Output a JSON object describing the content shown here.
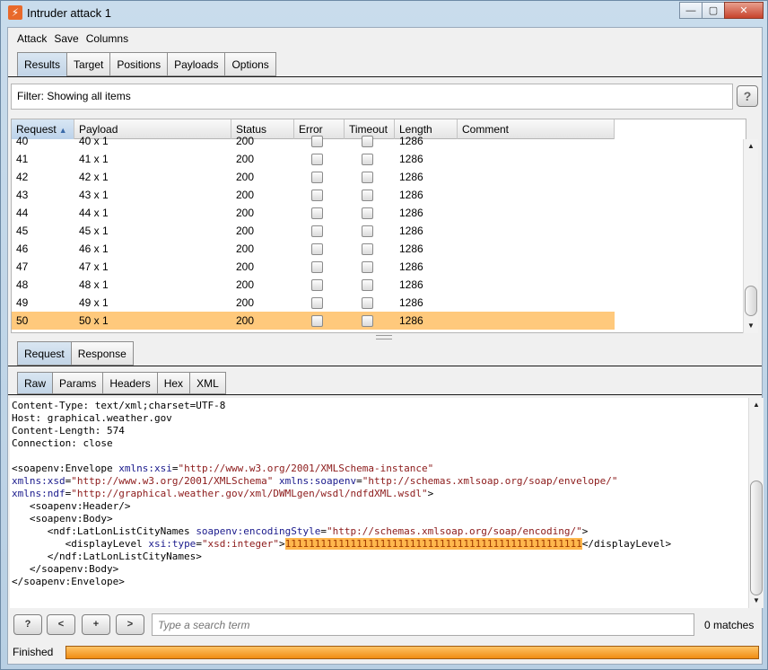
{
  "window": {
    "title": "Intruder attack 1"
  },
  "menu": [
    "Attack",
    "Save",
    "Columns"
  ],
  "top_tabs": [
    "Results",
    "Target",
    "Positions",
    "Payloads",
    "Options"
  ],
  "filter": {
    "text": "Filter: Showing all items",
    "help": "?"
  },
  "table": {
    "columns": [
      "Request",
      "Payload",
      "Status",
      "Error",
      "Timeout",
      "Length",
      "Comment"
    ],
    "sort_indicator": "▲",
    "rows": [
      {
        "request": "40",
        "payload": "40 x 1",
        "status": "200",
        "error": false,
        "timeout": false,
        "length": "1286",
        "comment": ""
      },
      {
        "request": "41",
        "payload": "41 x 1",
        "status": "200",
        "error": false,
        "timeout": false,
        "length": "1286",
        "comment": ""
      },
      {
        "request": "42",
        "payload": "42 x 1",
        "status": "200",
        "error": false,
        "timeout": false,
        "length": "1286",
        "comment": ""
      },
      {
        "request": "43",
        "payload": "43 x 1",
        "status": "200",
        "error": false,
        "timeout": false,
        "length": "1286",
        "comment": ""
      },
      {
        "request": "44",
        "payload": "44 x 1",
        "status": "200",
        "error": false,
        "timeout": false,
        "length": "1286",
        "comment": ""
      },
      {
        "request": "45",
        "payload": "45 x 1",
        "status": "200",
        "error": false,
        "timeout": false,
        "length": "1286",
        "comment": ""
      },
      {
        "request": "46",
        "payload": "46 x 1",
        "status": "200",
        "error": false,
        "timeout": false,
        "length": "1286",
        "comment": ""
      },
      {
        "request": "47",
        "payload": "47 x 1",
        "status": "200",
        "error": false,
        "timeout": false,
        "length": "1286",
        "comment": ""
      },
      {
        "request": "48",
        "payload": "48 x 1",
        "status": "200",
        "error": false,
        "timeout": false,
        "length": "1286",
        "comment": ""
      },
      {
        "request": "49",
        "payload": "49 x 1",
        "status": "200",
        "error": false,
        "timeout": false,
        "length": "1286",
        "comment": ""
      },
      {
        "request": "50",
        "payload": "50 x 1",
        "status": "200",
        "error": false,
        "timeout": false,
        "length": "1286",
        "comment": "",
        "selected": true
      }
    ]
  },
  "mid_tabs": [
    "Request",
    "Response"
  ],
  "sub_tabs": [
    "Raw",
    "Params",
    "Headers",
    "Hex",
    "XML"
  ],
  "editor": {
    "lines": [
      [
        {
          "t": "Content-Type: text/xml;charset=UTF-8"
        }
      ],
      [
        {
          "t": "Host: graphical.weather.gov"
        }
      ],
      [
        {
          "t": "Content-Length: 574"
        }
      ],
      [
        {
          "t": "Connection: close"
        }
      ],
      [
        {
          "t": ""
        }
      ],
      [
        {
          "t": "<soapenv:Envelope "
        },
        {
          "t": "xmlns:xsi",
          "c": "att"
        },
        {
          "t": "="
        },
        {
          "t": "\"http://www.w3.org/2001/XMLSchema-instance\"",
          "c": "val"
        }
      ],
      [
        {
          "t": "xmlns:xsd",
          "c": "att"
        },
        {
          "t": "="
        },
        {
          "t": "\"http://www.w3.org/2001/XMLSchema\"",
          "c": "val"
        },
        {
          "t": " "
        },
        {
          "t": "xmlns:soapenv",
          "c": "att"
        },
        {
          "t": "="
        },
        {
          "t": "\"http://schemas.xmlsoap.org/soap/envelope/\"",
          "c": "val"
        }
      ],
      [
        {
          "t": "xmlns:ndf",
          "c": "att"
        },
        {
          "t": "="
        },
        {
          "t": "\"http://graphical.weather.gov/xml/DWMLgen/wsdl/ndfdXML.wsdl\"",
          "c": "val"
        },
        {
          "t": ">"
        }
      ],
      [
        {
          "t": "   <soapenv:Header/>"
        }
      ],
      [
        {
          "t": "   <soapenv:Body>"
        }
      ],
      [
        {
          "t": "      <ndf:LatLonListCityNames "
        },
        {
          "t": "soapenv:encodingStyle",
          "c": "att"
        },
        {
          "t": "="
        },
        {
          "t": "\"http://schemas.xmlsoap.org/soap/encoding/\"",
          "c": "val"
        },
        {
          "t": ">"
        }
      ],
      [
        {
          "t": "         <displayLevel "
        },
        {
          "t": "xsi:type",
          "c": "att"
        },
        {
          "t": "="
        },
        {
          "t": "\"xsd:integer\"",
          "c": "val"
        },
        {
          "t": ">"
        },
        {
          "t": "11111111111111111111111111111111111111111111111111",
          "c": "hl"
        },
        {
          "t": "</displayLevel>"
        }
      ],
      [
        {
          "t": "      </ndf:LatLonListCityNames>"
        }
      ],
      [
        {
          "t": "   </soapenv:Body>"
        }
      ],
      [
        {
          "t": "</soapenv:Envelope>"
        }
      ]
    ]
  },
  "search": {
    "help": "?",
    "prev": "<",
    "add": "+",
    "next": ">",
    "placeholder": "Type a search term",
    "matches": "0 matches"
  },
  "status": {
    "text": "Finished",
    "progress": 1.0
  },
  "colors": {
    "selected_row": "#ffc97c",
    "progress": "#f08c12",
    "highlight": "#ffb74d"
  }
}
